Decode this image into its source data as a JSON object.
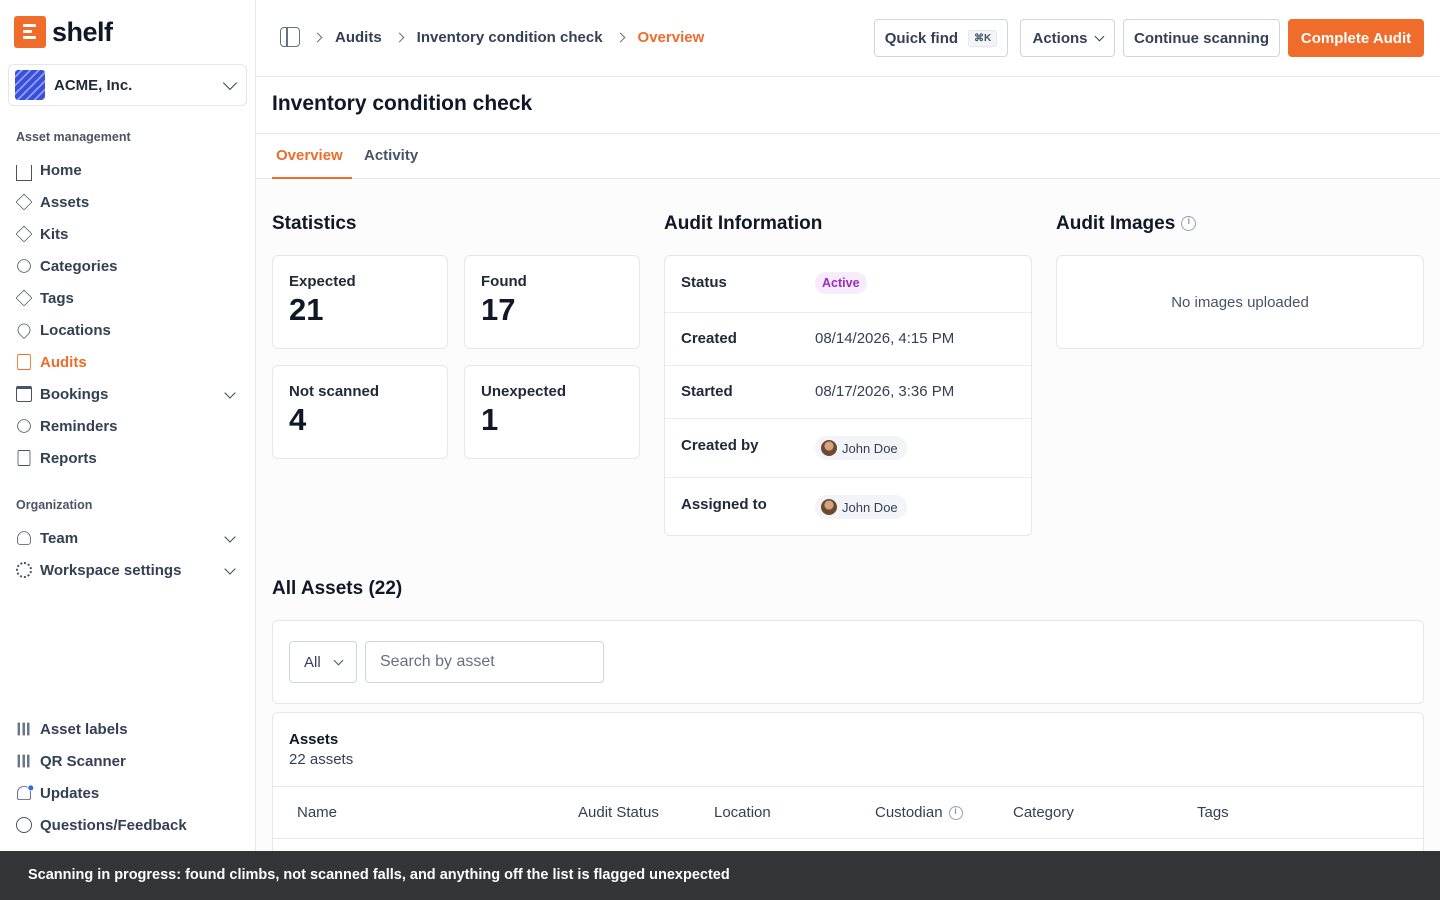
{
  "brand": {
    "name": "shelf",
    "color": "#ef6c2b"
  },
  "org": {
    "name": "ACME, Inc."
  },
  "sidebar": {
    "section_asset": "Asset management",
    "section_org": "Organization",
    "items": [
      {
        "label": "Home",
        "icon": "home-icon"
      },
      {
        "label": "Assets",
        "icon": "assets-icon"
      },
      {
        "label": "Kits",
        "icon": "kits-icon"
      },
      {
        "label": "Categories",
        "icon": "categories-icon"
      },
      {
        "label": "Tags",
        "icon": "tag-icon"
      },
      {
        "label": "Locations",
        "icon": "location-icon"
      },
      {
        "label": "Audits",
        "icon": "audit-icon",
        "active": true
      },
      {
        "label": "Bookings",
        "icon": "calendar-icon",
        "expandable": true
      },
      {
        "label": "Reminders",
        "icon": "alarm-icon"
      },
      {
        "label": "Reports",
        "icon": "report-icon"
      }
    ],
    "org_items": [
      {
        "label": "Team",
        "icon": "user-icon",
        "expandable": true
      },
      {
        "label": "Workspace settings",
        "icon": "gear-icon",
        "expandable": true
      }
    ],
    "bottom_items": [
      {
        "label": "Asset labels",
        "icon": "qr-icon"
      },
      {
        "label": "QR Scanner",
        "icon": "scan-icon"
      },
      {
        "label": "Updates",
        "icon": "bell-icon",
        "has_notification": true
      },
      {
        "label": "Questions/Feedback",
        "icon": "chat-icon"
      }
    ]
  },
  "breadcrumbs": [
    "Audits",
    "Inventory condition check",
    "Overview"
  ],
  "header": {
    "quick_find": "Quick find",
    "quick_find_shortcut": "⌘K",
    "actions": "Actions",
    "continue_scanning": "Continue scanning",
    "complete_audit": "Complete Audit"
  },
  "page": {
    "title": "Inventory condition check",
    "tabs": [
      "Overview",
      "Activity"
    ]
  },
  "statistics": {
    "title": "Statistics",
    "cards": [
      {
        "label": "Expected",
        "value": "21"
      },
      {
        "label": "Found",
        "value": "17"
      },
      {
        "label": "Not scanned",
        "value": "4"
      },
      {
        "label": "Unexpected",
        "value": "1"
      }
    ]
  },
  "audit_info": {
    "title": "Audit Information",
    "status_label": "Status",
    "status_value": "Active",
    "created_label": "Created",
    "created_value": "08/14/2026, 4:15 PM",
    "started_label": "Started",
    "started_value": "08/17/2026, 3:36 PM",
    "created_by_label": "Created by",
    "created_by_value": "John Doe",
    "assigned_label": "Assigned to",
    "assigned_value": "John Doe"
  },
  "audit_images": {
    "title": "Audit Images",
    "empty": "No images uploaded"
  },
  "assets": {
    "title": "All Assets (22)",
    "filter_value": "All",
    "search_placeholder": "Search by asset",
    "table_title": "Assets",
    "table_count": "22 assets",
    "columns": [
      "Name",
      "Audit Status",
      "Location",
      "Custodian",
      "Category",
      "Tags"
    ]
  },
  "toast": "Scanning in progress: found climbs, not scanned falls, and anything off the list is flagged unexpected"
}
